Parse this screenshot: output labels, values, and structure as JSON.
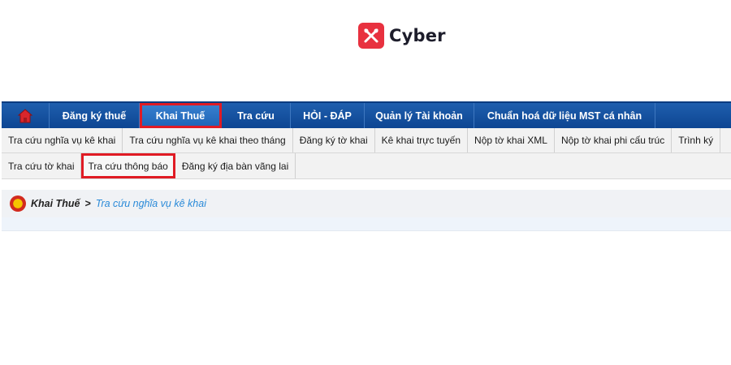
{
  "logo": {
    "text": "Cyber",
    "brand_color": "#e8313f"
  },
  "main_nav": {
    "home_icon": "home-icon",
    "items": [
      {
        "label": "Đăng ký thuế",
        "width": 110
      },
      {
        "label": "Khai Thuế",
        "width": 100,
        "active": true
      },
      {
        "label": "Tra cứu",
        "width": 84
      },
      {
        "label": "HỎI - ĐÁP",
        "width": 90
      },
      {
        "label": "Quản lý Tài khoản",
        "width": 134
      },
      {
        "label": "Chuẩn hoá dữ liệu MST cá nhân",
        "width": 222
      }
    ],
    "bar_color": "#0d4592",
    "highlight_color": "#e01b24"
  },
  "sub_nav": {
    "row1": [
      "Tra cứu nghĩa vụ kê khai",
      "Tra cứu nghĩa vụ kê khai theo tháng",
      "Đăng ký tờ khai",
      "Kê khai trực tuyến",
      "Nộp tờ khai XML",
      "Nộp tờ khai phi cấu trúc",
      "Trình ký"
    ],
    "row2": [
      "Tra cứu tờ khai",
      "Tra cứu thông báo",
      "Đăng ký địa bàn vãng lai"
    ]
  },
  "breadcrumb": {
    "emblem_icon": "national-emblem-icon",
    "root": "Khai Thuế",
    "separator": ">",
    "current": "Tra cứu nghĩa vụ kê khai"
  }
}
